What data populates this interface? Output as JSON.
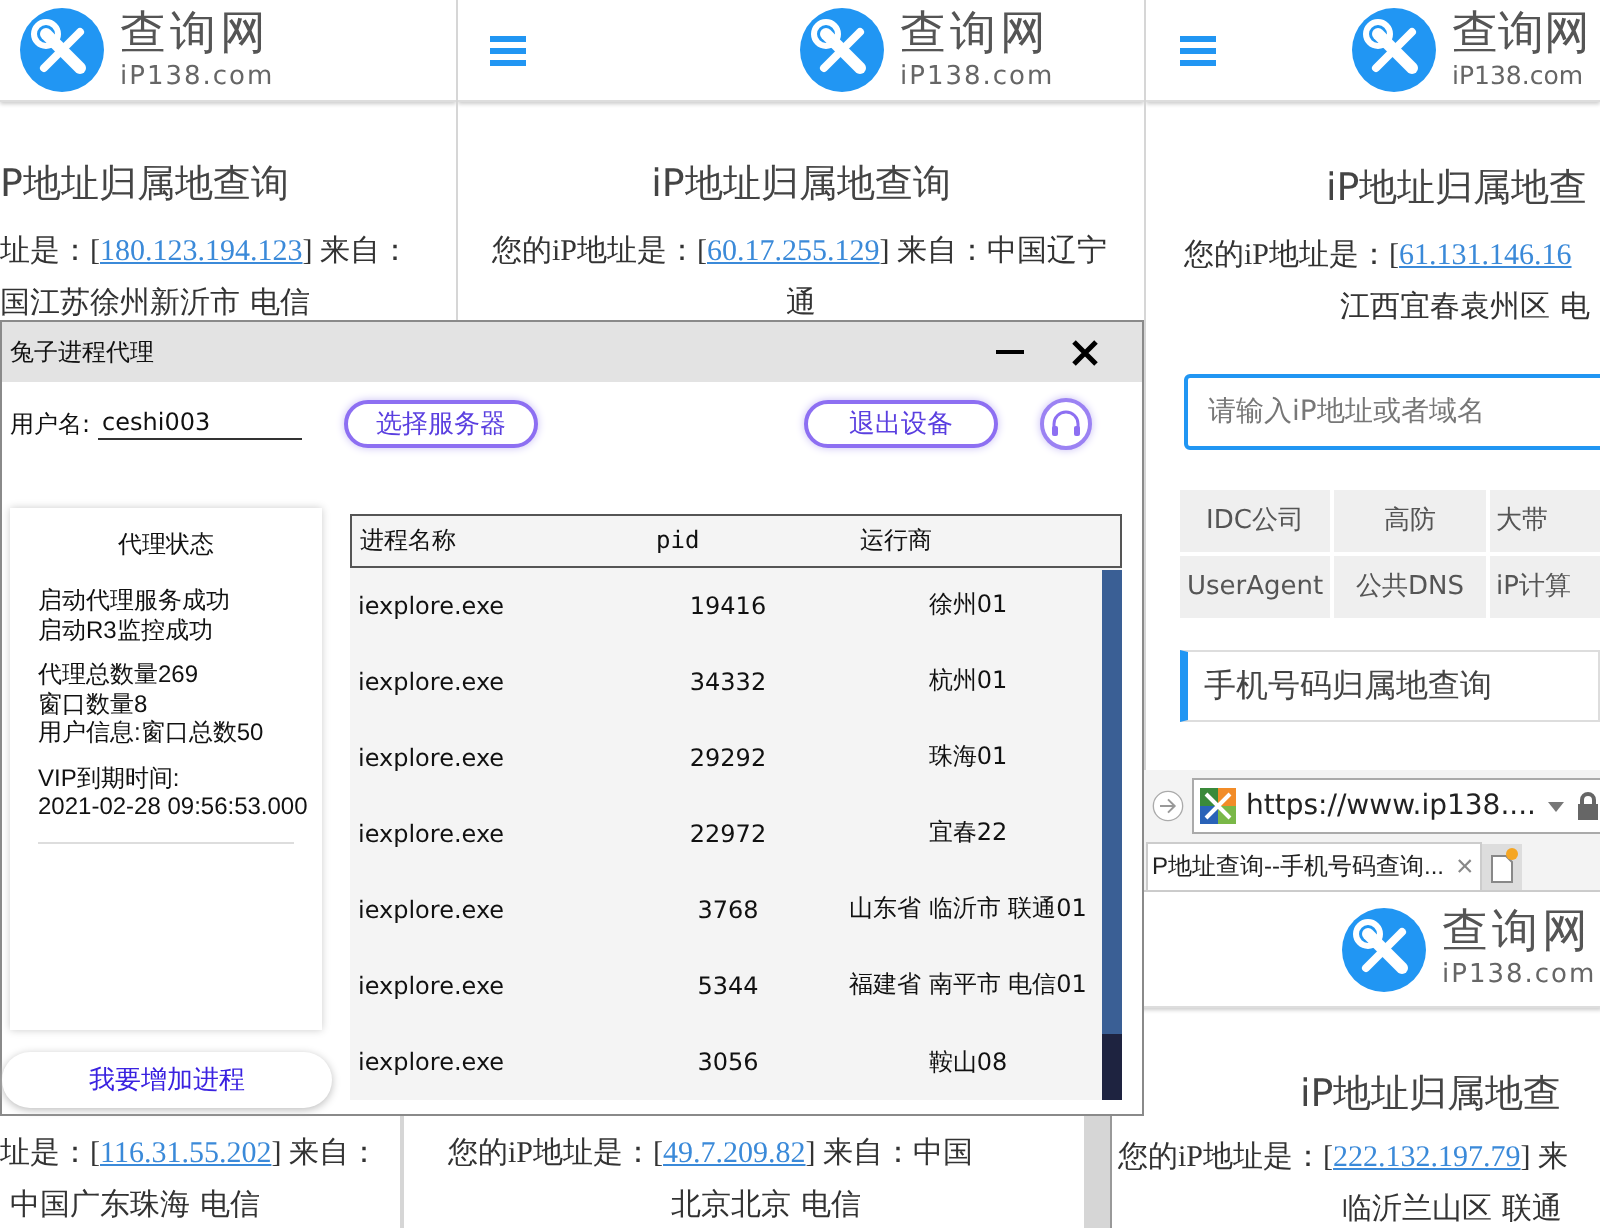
{
  "pages": [
    {
      "kind": "page-left",
      "logo": {
        "name": "查询网",
        "domain": "iP138.com"
      },
      "title": "P地址归属地查询",
      "ip_line": {
        "prefix": "址是：[",
        "ip": "180.123.194.123",
        "suffix": "] 来自："
      },
      "location": "国江苏徐州新沂市 电信"
    },
    {
      "kind": "page-center",
      "logo": {
        "name": "查询网",
        "domain": "iP138.com"
      },
      "title": "iP地址归属地查询",
      "ip_line": {
        "prefix": "您的iP地址是：[",
        "ip": "60.17.255.129",
        "suffix": "] 来自：中国辽宁"
      },
      "location": "通"
    },
    {
      "kind": "page-right",
      "logo": {
        "name": "查询网",
        "domain": "iP138.com"
      },
      "title": "iP地址归属地查",
      "ip_line": {
        "prefix": "您的iP地址是：[",
        "ip": "61.131.146.16"
      },
      "location": "江西宜春袁州区 电",
      "search": {
        "placeholder": "请输入iP地址或者域名"
      },
      "quick_links": [
        "IDC公司",
        "高防",
        "大带",
        "UserAgent",
        "公共DNS",
        "iP计算"
      ],
      "section_title": "手机号码归属地查询"
    },
    {
      "kind": "page-bottom",
      "ip_line": {
        "prefix": "址是：[",
        "ip": "116.31.55.202",
        "suffix": "] 来自："
      },
      "location": "中国广东珠海 电信"
    },
    {
      "kind": "page-bottom",
      "ip_line": {
        "prefix": "您的iP地址是：[",
        "ip": "49.7.209.82",
        "suffix": "] 来自：中国"
      },
      "location": "北京北京 电信"
    }
  ],
  "ie_window": {
    "address": "https://www.ip138....",
    "tab": {
      "title": "P地址查询--手机号码查询...",
      "close": "×"
    },
    "page": {
      "logo": {
        "name": "查询网",
        "domain": "iP138.com"
      },
      "title": "iP地址归属地查",
      "ip_line": {
        "prefix": "您的iP地址是：[",
        "ip": "222.132.197.79",
        "suffix": "] 来"
      },
      "location": "临沂兰山区 联通"
    }
  },
  "dialog": {
    "title": "兔子进程代理",
    "username_label": "用户名:",
    "username": "ceshi003",
    "buttons": [
      "选择服务器",
      "退出设备"
    ],
    "status_panel": {
      "title": "代理状态",
      "groups": [
        [
          "启动代理服务成功",
          "启动R3监控成功"
        ],
        [
          "代理总数量269",
          "窗口数量8",
          "用户信息:窗口总数50"
        ],
        [
          "VIP到期时间:",
          "2021-02-28 09:56:53.000"
        ]
      ]
    },
    "add_button": "我要增加进程",
    "table": {
      "columns": [
        "进程名称",
        "pid",
        "运行商"
      ],
      "rows": [
        [
          "iexplore.exe",
          "19416",
          "徐州01"
        ],
        [
          "iexplore.exe",
          "34332",
          "杭州01"
        ],
        [
          "iexplore.exe",
          "29292",
          "珠海01"
        ],
        [
          "iexplore.exe",
          "22972",
          "宜春22"
        ],
        [
          "iexplore.exe",
          "3768",
          "山东省 临沂市 联通01"
        ],
        [
          "iexplore.exe",
          "5344",
          "福建省 南平市 电信01"
        ],
        [
          "iexplore.exe",
          "3056",
          "鞍山08"
        ]
      ]
    }
  }
}
